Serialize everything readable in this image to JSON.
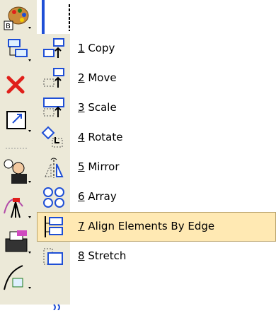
{
  "menu": {
    "items": [
      {
        "mnemonic": "1",
        "label": "Copy",
        "icon": "copy-icon"
      },
      {
        "mnemonic": "2",
        "label": "Move",
        "icon": "move-icon"
      },
      {
        "mnemonic": "3",
        "label": "Scale",
        "icon": "scale-icon"
      },
      {
        "mnemonic": "4",
        "label": "Rotate",
        "icon": "rotate-icon"
      },
      {
        "mnemonic": "5",
        "label": "Mirror",
        "icon": "mirror-icon"
      },
      {
        "mnemonic": "6",
        "label": "Array",
        "icon": "array-icon"
      },
      {
        "mnemonic": "7",
        "label": "Align Elements By Edge",
        "icon": "align-edge-icon"
      },
      {
        "mnemonic": "8",
        "label": "Stretch",
        "icon": "stretch-icon"
      }
    ],
    "highlighted_index": 6
  },
  "toolbar": {
    "icons": [
      "palette-icon",
      "manipulate-icon",
      "delete-icon",
      "scale-tool-icon",
      "separator-grip",
      "measure-person-icon",
      "surveyor-icon",
      "printer-icon",
      "curve-icon"
    ]
  },
  "colors": {
    "highlight_bg": "#ffe9b3",
    "highlight_border": "#b9a26b",
    "accent_blue": "#1f4fd6",
    "toolbar_bg": "#ece9d8",
    "delete_red": "#e0201b"
  }
}
